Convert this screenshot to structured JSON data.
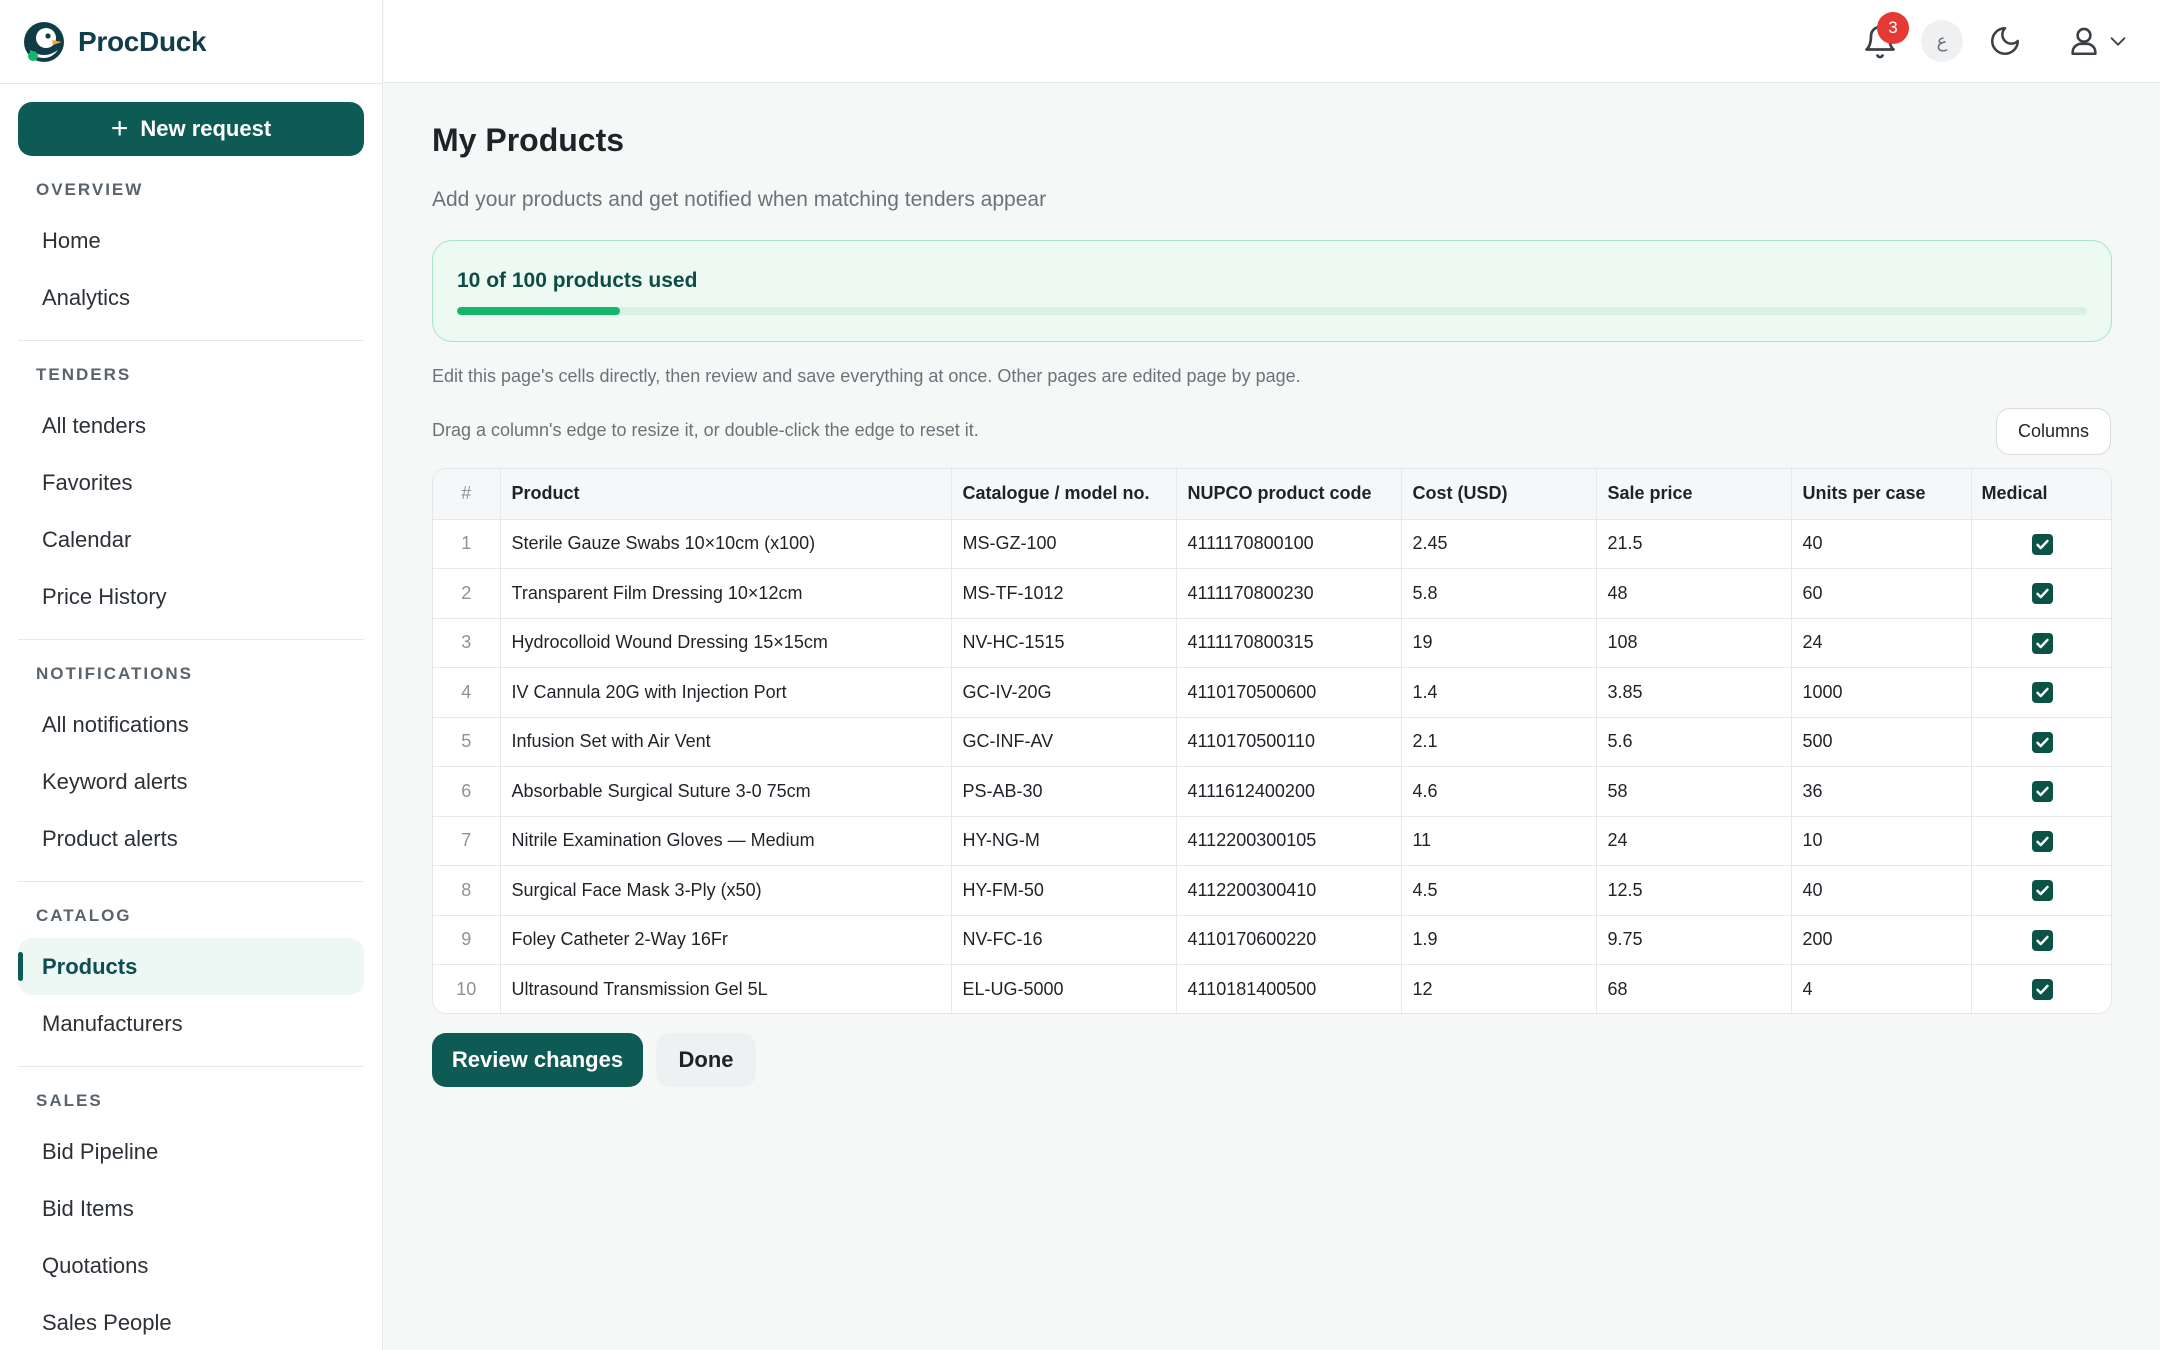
{
  "app": {
    "name": "ProcDuck"
  },
  "sidebar": {
    "new_request_label": "New request",
    "sections": [
      {
        "title": "OVERVIEW",
        "items": [
          {
            "label": "Home"
          },
          {
            "label": "Analytics"
          }
        ]
      },
      {
        "title": "TENDERS",
        "items": [
          {
            "label": "All tenders"
          },
          {
            "label": "Favorites"
          },
          {
            "label": "Calendar"
          },
          {
            "label": "Price History"
          }
        ]
      },
      {
        "title": "NOTIFICATIONS",
        "items": [
          {
            "label": "All notifications"
          },
          {
            "label": "Keyword alerts"
          },
          {
            "label": "Product alerts"
          }
        ]
      },
      {
        "title": "CATALOG",
        "items": [
          {
            "label": "Products",
            "active": true
          },
          {
            "label": "Manufacturers"
          }
        ]
      },
      {
        "title": "SALES",
        "items": [
          {
            "label": "Bid Pipeline"
          },
          {
            "label": "Bid Items"
          },
          {
            "label": "Quotations"
          },
          {
            "label": "Sales People"
          }
        ]
      }
    ]
  },
  "topbar": {
    "notification_count": "3",
    "language_glyph": "ع",
    "icons": [
      "bell-icon",
      "moon-icon",
      "user-icon",
      "chevron-down-icon"
    ]
  },
  "main": {
    "title": "My Products",
    "subtitle": "Add your products and get notified when matching tenders appear",
    "usage": {
      "text": "10 of 100 products used",
      "used": 10,
      "limit": 100
    },
    "hint_edit": "Edit this page's cells directly, then review and save everything at once. Other pages are edited page by page.",
    "hint_resize": "Drag a column's edge to resize it, or double-click the edge to reset it.",
    "columns_button": "Columns",
    "table": {
      "headers": [
        "#",
        "Product",
        "Catalogue / model no.",
        "NUPCO product code",
        "Cost (USD)",
        "Sale price",
        "Units per case",
        "Medical"
      ],
      "rows": [
        [
          "1",
          "Sterile Gauze Swabs 10×10cm (x100)",
          "MS-GZ-100",
          "4111170800100",
          "2.45",
          "21.5",
          "40",
          true
        ],
        [
          "2",
          "Transparent Film Dressing 10×12cm",
          "MS-TF-1012",
          "4111170800230",
          "5.8",
          "48",
          "60",
          true
        ],
        [
          "3",
          "Hydrocolloid Wound Dressing 15×15cm",
          "NV-HC-1515",
          "4111170800315",
          "19",
          "108",
          "24",
          true
        ],
        [
          "4",
          "IV Cannula 20G with Injection Port",
          "GC-IV-20G",
          "4110170500600",
          "1.4",
          "3.85",
          "1000",
          true
        ],
        [
          "5",
          "Infusion Set with Air Vent",
          "GC-INF-AV",
          "4110170500110",
          "2.1",
          "5.6",
          "500",
          true
        ],
        [
          "6",
          "Absorbable Surgical Suture 3-0 75cm",
          "PS-AB-30",
          "4111612400200",
          "4.6",
          "58",
          "36",
          true
        ],
        [
          "7",
          "Nitrile Examination Gloves — Medium",
          "HY-NG-M",
          "4112200300105",
          "11",
          "24",
          "10",
          true
        ],
        [
          "8",
          "Surgical Face Mask 3-Ply (x50)",
          "HY-FM-50",
          "4112200300410",
          "4.5",
          "12.5",
          "40",
          true
        ],
        [
          "9",
          "Foley Catheter 2-Way 16Fr",
          "NV-FC-16",
          "4110170600220",
          "1.9",
          "9.75",
          "200",
          true
        ],
        [
          "10",
          "Ultrasound Transmission Gel 5L",
          "EL-UG-5000",
          "4110181400500",
          "12",
          "68",
          "4",
          true
        ]
      ]
    },
    "review_button": "Review changes",
    "done_button": "Done"
  },
  "colors": {
    "brand": "#0e5a55",
    "accent_green": "#12b76a",
    "badge_red": "#e53935"
  }
}
